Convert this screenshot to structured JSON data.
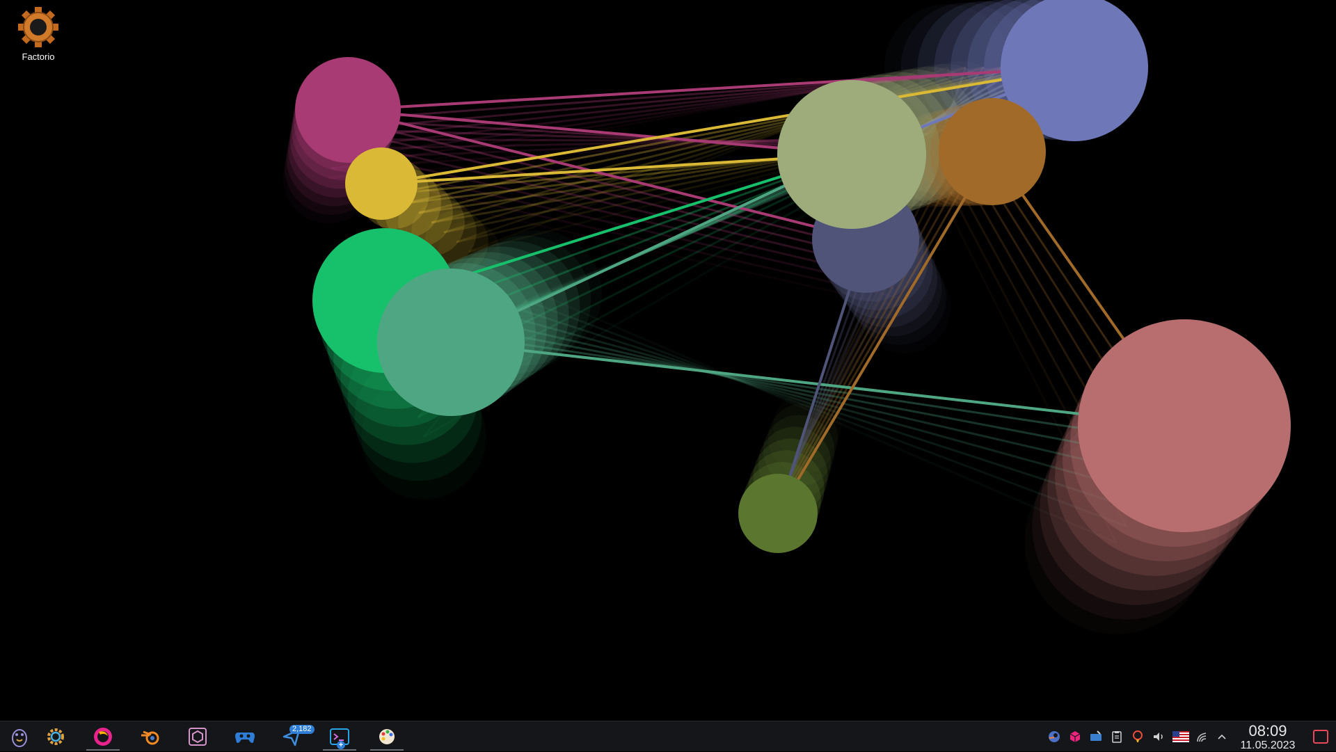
{
  "desktop": {
    "icons": [
      {
        "label": "Factorio",
        "icon": "factorio-gear-icon"
      }
    ]
  },
  "wallpaper": {
    "description_colors": {
      "magenta": "#a83a74",
      "yellow": "#d9b935",
      "green": "#17c06b",
      "teal": "#4fa683",
      "sage": "#9eab7b",
      "periwinkle": "#6e78b8",
      "orange": "#a26a28",
      "slate": "#4f5478",
      "olive": "#5a762f",
      "salmon": "#b86e6e"
    }
  },
  "taskbar": {
    "apps": [
      {
        "name": "application-launcher",
        "icon": "kde-menu-icon"
      },
      {
        "name": "system-settings",
        "icon": "gear-icon"
      },
      {
        "name": "firefox",
        "icon": "browser-icon",
        "active": true
      },
      {
        "name": "blender",
        "icon": "blender-icon"
      },
      {
        "name": "unity-hub",
        "icon": "unity-icon"
      },
      {
        "name": "game-controller",
        "icon": "gamepad-icon"
      },
      {
        "name": "discover",
        "icon": "discover-icon",
        "badge": "2,182"
      },
      {
        "name": "terminal",
        "icon": "terminal-icon",
        "active": true
      },
      {
        "name": "paint",
        "icon": "palette-icon",
        "active": true
      }
    ],
    "tray": [
      "steam-icon",
      "package-icon",
      "monitor-icon",
      "clipboard-icon",
      "notification-icon",
      "volume-icon",
      "keyboard-layout-flag-icon",
      "network-icon",
      "expand-arrow-icon"
    ],
    "clock": {
      "time": "08:09",
      "date": "11.05.2023"
    }
  }
}
